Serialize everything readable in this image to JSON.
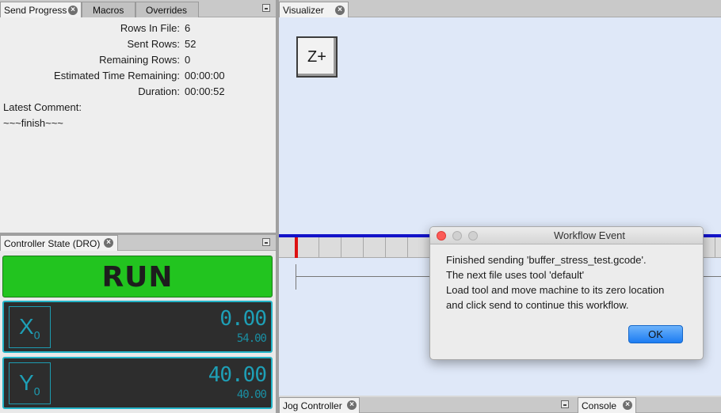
{
  "left_tabs": {
    "tabs": [
      {
        "label": "Send Progress",
        "active": true
      },
      {
        "label": "Macros",
        "active": false
      },
      {
        "label": "Overrides",
        "active": false
      }
    ]
  },
  "send_progress": {
    "rows_in_file_label": "Rows In File:",
    "rows_in_file": "6",
    "sent_rows_label": "Sent Rows:",
    "sent_rows": "52",
    "remaining_rows_label": "Remaining Rows:",
    "remaining_rows": "0",
    "time_remaining_label": "Estimated Time Remaining:",
    "time_remaining": "00:00:00",
    "duration_label": "Duration:",
    "duration": "00:00:52",
    "latest_comment_label": "Latest Comment:",
    "latest_comment": "~~~finish~~~"
  },
  "dro": {
    "tab_label": "Controller State (DRO)",
    "state": "RUN",
    "state_color": "#22c41f",
    "axes": [
      {
        "letter": "X",
        "sub": "0",
        "work": "0.00",
        "machine": "54.00"
      },
      {
        "letter": "Y",
        "sub": "0",
        "work": "40.00",
        "machine": "40.00"
      }
    ],
    "accent_color": "#1e9fb6"
  },
  "visualizer": {
    "tab_label": "Visualizer",
    "view_cube_label": "Z+",
    "toolpath_color": "#1313c9"
  },
  "dialog": {
    "title": "Workflow Event",
    "lines": [
      "Finished sending 'buffer_stress_test.gcode'.",
      "The next file uses tool 'default'",
      "Load tool and move machine to its zero location",
      "and click send to continue this workflow."
    ],
    "ok_label": "OK"
  },
  "bottom_tabs": {
    "jog_label": "Jog Controller",
    "console_label": "Console"
  }
}
